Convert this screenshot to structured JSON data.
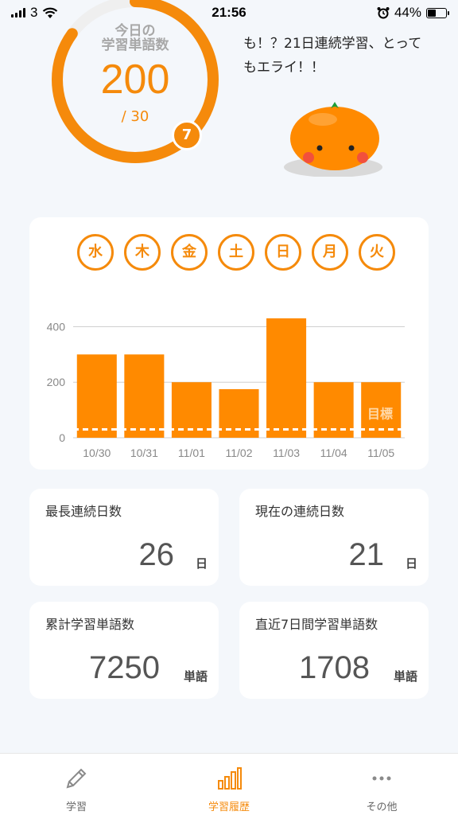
{
  "status": {
    "carrier": "3",
    "time": "21:56",
    "battery": "44%",
    "battery_level": 0.44
  },
  "today": {
    "title_line1": "今日の",
    "title_line2": "学習単語数",
    "count": "200",
    "goal": "/ 30",
    "streak_badge": "7",
    "progress": 0.85
  },
  "message": "も！？21日連続学習、とってもエライ！！",
  "weekdays": [
    "水",
    "木",
    "金",
    "土",
    "日",
    "月",
    "火"
  ],
  "chart_data": {
    "type": "bar",
    "categories": [
      "10/30",
      "10/31",
      "11/01",
      "11/02",
      "11/03",
      "11/04",
      "11/05"
    ],
    "values": [
      300,
      300,
      200,
      175,
      430,
      200,
      200
    ],
    "yticks": [
      0,
      200,
      400
    ],
    "ylim": [
      0,
      450
    ],
    "goal_value": 30,
    "goal_label": "目標",
    "bar_color": "#ff8a00"
  },
  "stats": {
    "longest_streak": {
      "label": "最長連続日数",
      "value": "26",
      "unit": "日"
    },
    "current_streak": {
      "label": "現在の連続日数",
      "value": "21",
      "unit": "日"
    },
    "total_words": {
      "label": "累計学習単語数",
      "value": "7250",
      "unit": "単語"
    },
    "recent_words": {
      "label": "直近7日間学習単語数",
      "value": "1708",
      "unit": "単語"
    }
  },
  "tabs": [
    {
      "label": "学習",
      "icon": "pencil-icon"
    },
    {
      "label": "学習履歴",
      "icon": "bar-chart-icon"
    },
    {
      "label": "その他",
      "icon": "more-icon"
    }
  ],
  "colors": {
    "accent": "#f58a0b",
    "background": "#f4f7fb"
  }
}
